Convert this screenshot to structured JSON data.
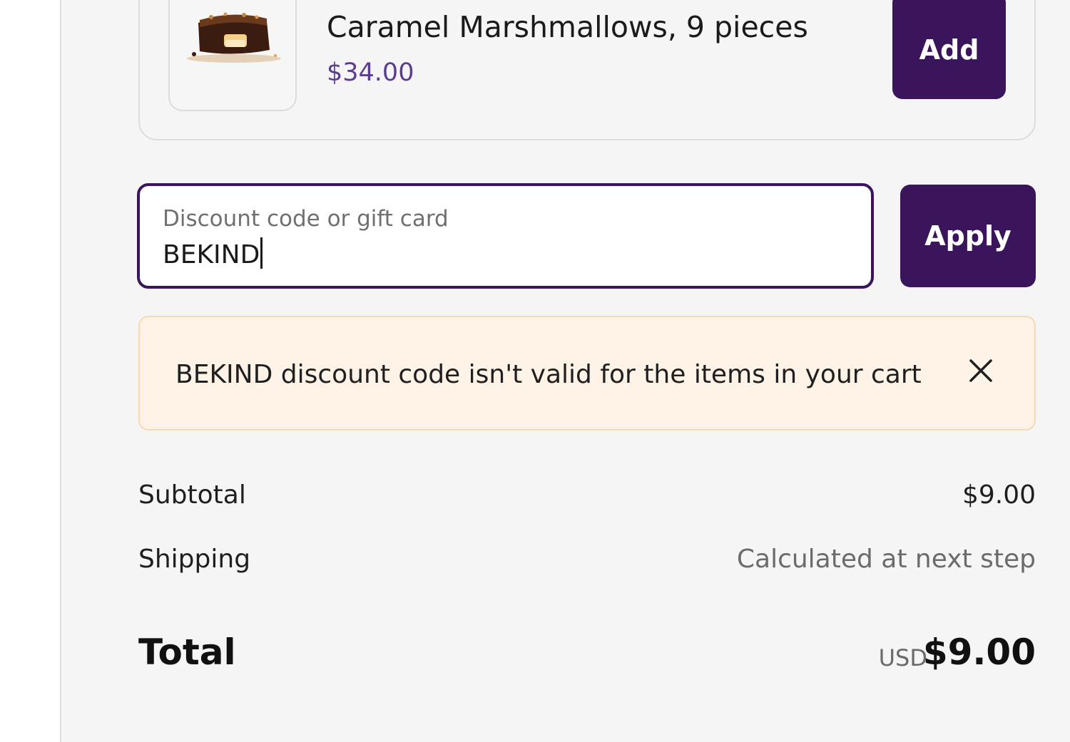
{
  "upsell": {
    "product_title": "Caramel Marshmallows, 9 pieces",
    "price": "$34.00",
    "add_label": "Add",
    "thumbnail_icon": "chocolate-caramel-image"
  },
  "discount": {
    "label": "Discount code or gift card",
    "value": "BEKIND",
    "apply_label": "Apply"
  },
  "warning": {
    "code": "BEKIND",
    "message": " discount code isn't valid for the items in your cart",
    "close_icon": "close-icon"
  },
  "summary": {
    "subtotal_label": "Subtotal",
    "subtotal_value": "$9.00",
    "shipping_label": "Shipping",
    "shipping_value": "Calculated at next step",
    "total_label": "Total",
    "total_currency": "USD",
    "total_value": "$9.00"
  },
  "colors": {
    "brand": "#3b155b",
    "price": "#5b3d8f",
    "warning_bg": "#fff3e8",
    "warning_border": "#f9d9b2",
    "panel_bg": "#f5f5f5"
  }
}
